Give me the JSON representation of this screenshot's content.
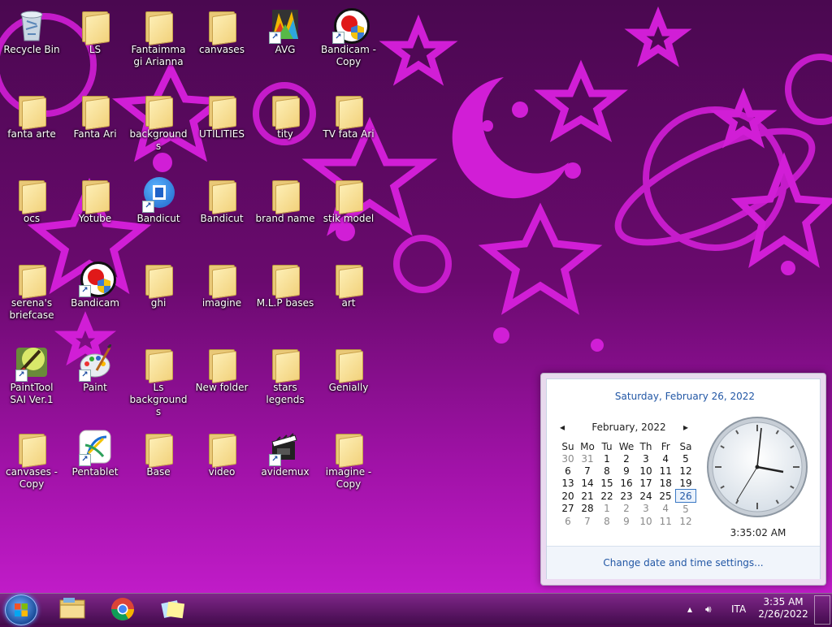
{
  "desktop": {
    "icons": [
      {
        "label": "Recycle Bin",
        "kind": "recycle"
      },
      {
        "label": "LS",
        "kind": "folder"
      },
      {
        "label": "Fantaimmagi Arianna",
        "kind": "folder"
      },
      {
        "label": "canvases",
        "kind": "folder"
      },
      {
        "label": "AVG",
        "kind": "avg"
      },
      {
        "label": "Bandicam - Copy",
        "kind": "bandicam"
      },
      {
        "label": "fanta arte",
        "kind": "folder"
      },
      {
        "label": "Fanta Ari",
        "kind": "folder"
      },
      {
        "label": "backgrounds",
        "kind": "folder"
      },
      {
        "label": "UTILITIES",
        "kind": "folder"
      },
      {
        "label": "tity",
        "kind": "folder"
      },
      {
        "label": "TV  fata Ari",
        "kind": "folder"
      },
      {
        "label": "ocs",
        "kind": "folder"
      },
      {
        "label": "Yotube",
        "kind": "folder"
      },
      {
        "label": "Bandicut",
        "kind": "bandicut"
      },
      {
        "label": "Bandicut",
        "kind": "folder"
      },
      {
        "label": "brand name",
        "kind": "folder"
      },
      {
        "label": "stik  model",
        "kind": "folder"
      },
      {
        "label": "serena's briefcase",
        "kind": "folder"
      },
      {
        "label": "Bandicam",
        "kind": "bandicam"
      },
      {
        "label": "ghi",
        "kind": "folder"
      },
      {
        "label": "imagine",
        "kind": "folder"
      },
      {
        "label": "M.L.P bases",
        "kind": "folder"
      },
      {
        "label": "art",
        "kind": "folder"
      },
      {
        "label": "PaintTool SAI Ver.1",
        "kind": "sai"
      },
      {
        "label": "Paint",
        "kind": "paint"
      },
      {
        "label": "Ls backgrounds",
        "kind": "folder"
      },
      {
        "label": "New folder",
        "kind": "folder"
      },
      {
        "label": "stars legends",
        "kind": "folder"
      },
      {
        "label": "Genially",
        "kind": "folder"
      },
      {
        "label": "canvases - Copy",
        "kind": "folder"
      },
      {
        "label": "Pentablet",
        "kind": "pentablet"
      },
      {
        "label": "Base",
        "kind": "folder"
      },
      {
        "label": "video",
        "kind": "folder"
      },
      {
        "label": "avidemux",
        "kind": "avidemux"
      },
      {
        "label": "imagine - Copy",
        "kind": "folder"
      }
    ]
  },
  "taskbar": {
    "pinned": [
      "windows-explorer-icon",
      "chrome-icon",
      "sticky-notes-icon"
    ],
    "tray": {
      "language": "ITA",
      "time": "3:35 AM",
      "date": "2/26/2022"
    }
  },
  "calendar": {
    "long_date": "Saturday, February 26, 2022",
    "month_label": "February, 2022",
    "prev": "◂",
    "next": "▸",
    "weekdays": [
      "Su",
      "Mo",
      "Tu",
      "We",
      "Th",
      "Fr",
      "Sa"
    ],
    "weeks": [
      [
        "30",
        "31",
        "1",
        "2",
        "3",
        "4",
        "5"
      ],
      [
        "6",
        "7",
        "8",
        "9",
        "10",
        "11",
        "12"
      ],
      [
        "13",
        "14",
        "15",
        "16",
        "17",
        "18",
        "19"
      ],
      [
        "20",
        "21",
        "22",
        "23",
        "24",
        "25",
        "26"
      ],
      [
        "27",
        "28",
        "1",
        "2",
        "3",
        "4",
        "5"
      ],
      [
        "6",
        "7",
        "8",
        "9",
        "10",
        "11",
        "12"
      ]
    ],
    "today": "26",
    "clock_time": "3:35:02 AM",
    "change_link": "Change date and time settings..."
  },
  "colors": {
    "wallpaper_star": "#d11ed6",
    "link_blue": "#2257a5"
  }
}
